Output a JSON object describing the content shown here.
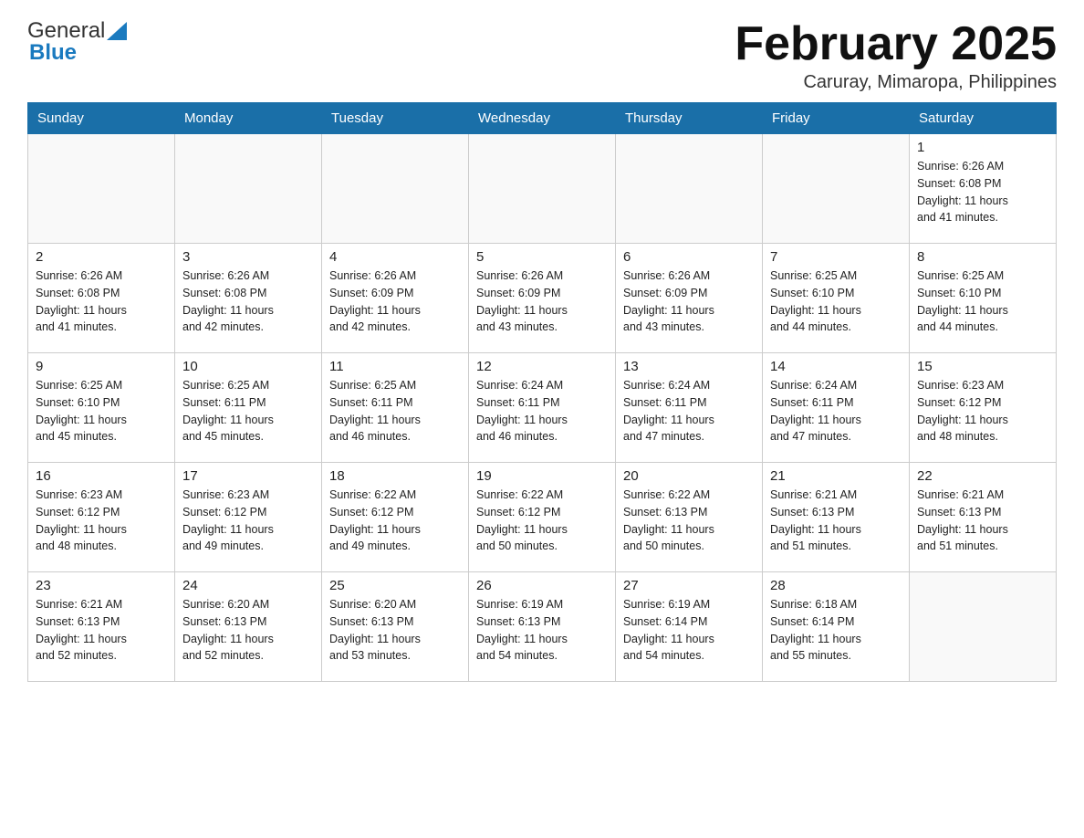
{
  "header": {
    "logo_general": "General",
    "logo_blue": "Blue",
    "month_title": "February 2025",
    "location": "Caruray, Mimaropa, Philippines"
  },
  "days_of_week": [
    "Sunday",
    "Monday",
    "Tuesday",
    "Wednesday",
    "Thursday",
    "Friday",
    "Saturday"
  ],
  "weeks": [
    [
      {
        "num": "",
        "info": ""
      },
      {
        "num": "",
        "info": ""
      },
      {
        "num": "",
        "info": ""
      },
      {
        "num": "",
        "info": ""
      },
      {
        "num": "",
        "info": ""
      },
      {
        "num": "",
        "info": ""
      },
      {
        "num": "1",
        "info": "Sunrise: 6:26 AM\nSunset: 6:08 PM\nDaylight: 11 hours\nand 41 minutes."
      }
    ],
    [
      {
        "num": "2",
        "info": "Sunrise: 6:26 AM\nSunset: 6:08 PM\nDaylight: 11 hours\nand 41 minutes."
      },
      {
        "num": "3",
        "info": "Sunrise: 6:26 AM\nSunset: 6:08 PM\nDaylight: 11 hours\nand 42 minutes."
      },
      {
        "num": "4",
        "info": "Sunrise: 6:26 AM\nSunset: 6:09 PM\nDaylight: 11 hours\nand 42 minutes."
      },
      {
        "num": "5",
        "info": "Sunrise: 6:26 AM\nSunset: 6:09 PM\nDaylight: 11 hours\nand 43 minutes."
      },
      {
        "num": "6",
        "info": "Sunrise: 6:26 AM\nSunset: 6:09 PM\nDaylight: 11 hours\nand 43 minutes."
      },
      {
        "num": "7",
        "info": "Sunrise: 6:25 AM\nSunset: 6:10 PM\nDaylight: 11 hours\nand 44 minutes."
      },
      {
        "num": "8",
        "info": "Sunrise: 6:25 AM\nSunset: 6:10 PM\nDaylight: 11 hours\nand 44 minutes."
      }
    ],
    [
      {
        "num": "9",
        "info": "Sunrise: 6:25 AM\nSunset: 6:10 PM\nDaylight: 11 hours\nand 45 minutes."
      },
      {
        "num": "10",
        "info": "Sunrise: 6:25 AM\nSunset: 6:11 PM\nDaylight: 11 hours\nand 45 minutes."
      },
      {
        "num": "11",
        "info": "Sunrise: 6:25 AM\nSunset: 6:11 PM\nDaylight: 11 hours\nand 46 minutes."
      },
      {
        "num": "12",
        "info": "Sunrise: 6:24 AM\nSunset: 6:11 PM\nDaylight: 11 hours\nand 46 minutes."
      },
      {
        "num": "13",
        "info": "Sunrise: 6:24 AM\nSunset: 6:11 PM\nDaylight: 11 hours\nand 47 minutes."
      },
      {
        "num": "14",
        "info": "Sunrise: 6:24 AM\nSunset: 6:11 PM\nDaylight: 11 hours\nand 47 minutes."
      },
      {
        "num": "15",
        "info": "Sunrise: 6:23 AM\nSunset: 6:12 PM\nDaylight: 11 hours\nand 48 minutes."
      }
    ],
    [
      {
        "num": "16",
        "info": "Sunrise: 6:23 AM\nSunset: 6:12 PM\nDaylight: 11 hours\nand 48 minutes."
      },
      {
        "num": "17",
        "info": "Sunrise: 6:23 AM\nSunset: 6:12 PM\nDaylight: 11 hours\nand 49 minutes."
      },
      {
        "num": "18",
        "info": "Sunrise: 6:22 AM\nSunset: 6:12 PM\nDaylight: 11 hours\nand 49 minutes."
      },
      {
        "num": "19",
        "info": "Sunrise: 6:22 AM\nSunset: 6:12 PM\nDaylight: 11 hours\nand 50 minutes."
      },
      {
        "num": "20",
        "info": "Sunrise: 6:22 AM\nSunset: 6:13 PM\nDaylight: 11 hours\nand 50 minutes."
      },
      {
        "num": "21",
        "info": "Sunrise: 6:21 AM\nSunset: 6:13 PM\nDaylight: 11 hours\nand 51 minutes."
      },
      {
        "num": "22",
        "info": "Sunrise: 6:21 AM\nSunset: 6:13 PM\nDaylight: 11 hours\nand 51 minutes."
      }
    ],
    [
      {
        "num": "23",
        "info": "Sunrise: 6:21 AM\nSunset: 6:13 PM\nDaylight: 11 hours\nand 52 minutes."
      },
      {
        "num": "24",
        "info": "Sunrise: 6:20 AM\nSunset: 6:13 PM\nDaylight: 11 hours\nand 52 minutes."
      },
      {
        "num": "25",
        "info": "Sunrise: 6:20 AM\nSunset: 6:13 PM\nDaylight: 11 hours\nand 53 minutes."
      },
      {
        "num": "26",
        "info": "Sunrise: 6:19 AM\nSunset: 6:13 PM\nDaylight: 11 hours\nand 54 minutes."
      },
      {
        "num": "27",
        "info": "Sunrise: 6:19 AM\nSunset: 6:14 PM\nDaylight: 11 hours\nand 54 minutes."
      },
      {
        "num": "28",
        "info": "Sunrise: 6:18 AM\nSunset: 6:14 PM\nDaylight: 11 hours\nand 55 minutes."
      },
      {
        "num": "",
        "info": ""
      }
    ]
  ]
}
